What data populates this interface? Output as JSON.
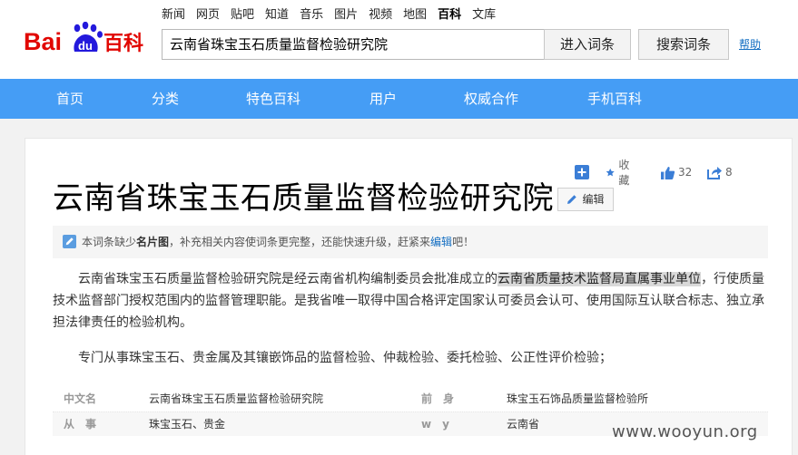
{
  "header": {
    "logo": {
      "bai": "Bai",
      "du": "du",
      "baike": "百科"
    },
    "topnav": [
      "新闻",
      "网页",
      "贴吧",
      "知道",
      "音乐",
      "图片",
      "视频",
      "地图",
      "百科",
      "文库"
    ],
    "topnav_active": "百科",
    "search_value": "云南省珠宝玉石质量监督检验研究院",
    "enter_button": "进入词条",
    "search_button": "搜索词条",
    "help": "帮助"
  },
  "navbar": {
    "items": [
      "首页",
      "分类",
      "特色百科",
      "用户",
      "权威合作",
      "手机百科"
    ]
  },
  "toolbar": {
    "favorite": "收藏",
    "like_count": "32",
    "share_count": "8"
  },
  "article": {
    "title": "云南省珠宝玉石质量监督检验研究院",
    "edit_label": "编辑",
    "notice": {
      "pre": "本词条缺少",
      "bold": "名片图",
      "mid": "，补充相关内容使词条更完整，还能快速升级，赶紧来",
      "link": "编辑",
      "post": "吧！"
    },
    "para1": {
      "pre": "云南省珠宝玉石质量监督检验研究院是经云南省机构编制委员会批准成立的",
      "highlight": "云南省质量技术监督局直属事业单位",
      "post": "，行使质量技术监督部门授权范围内的监督管理职能。是我省唯一取得中国合格评定国家认可委员会认可、使用国际互认联合标志、独立承担法律责任的检验机构。"
    },
    "para2": "专门从事珠宝玉石、贵金属及其镶嵌饰品的监督检验、仲裁检验、委托检验、公正性评价检验；",
    "basic_info": [
      {
        "label": "中文名",
        "value": "云南省珠宝玉石质量监督检验研究院",
        "label2": "前　身",
        "value2": "珠宝玉石饰品质量监督检验所"
      },
      {
        "label": "从　事",
        "value": "珠宝玉石、贵金",
        "label2": "w　y",
        "value2": "云南省"
      }
    ]
  },
  "watermark": "www.wooyun.org",
  "colors": {
    "nav_blue": "#459df5",
    "logo_red": "#e10601",
    "logo_blue": "#2319dc",
    "link_blue": "#136ec2"
  }
}
